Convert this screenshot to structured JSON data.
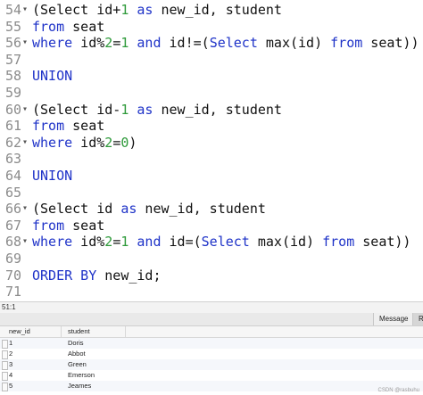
{
  "editor": {
    "lines": [
      {
        "n": "54",
        "fold": true,
        "tokens": [
          [
            "(Select id+",
            "t"
          ],
          [
            "1",
            "num"
          ],
          [
            " ",
            "t"
          ],
          [
            "as",
            "kw"
          ],
          [
            " new_id, student",
            "t"
          ]
        ]
      },
      {
        "n": "55",
        "fold": false,
        "tokens": [
          [
            "from",
            "kw"
          ],
          [
            " seat",
            "t"
          ]
        ]
      },
      {
        "n": "56",
        "fold": true,
        "tokens": [
          [
            "where",
            "kw"
          ],
          [
            " id%",
            "t"
          ],
          [
            "2",
            "num"
          ],
          [
            "=",
            "t"
          ],
          [
            "1",
            "num"
          ],
          [
            " ",
            "t"
          ],
          [
            "and",
            "kw"
          ],
          [
            " id!=(",
            "t"
          ],
          [
            "Select",
            "kw"
          ],
          [
            " max(id) ",
            "t"
          ],
          [
            "from",
            "kw"
          ],
          [
            " seat))",
            "t"
          ]
        ]
      },
      {
        "n": "57",
        "fold": false,
        "tokens": []
      },
      {
        "n": "58",
        "fold": false,
        "tokens": [
          [
            "UNION",
            "kw"
          ]
        ]
      },
      {
        "n": "59",
        "fold": false,
        "tokens": []
      },
      {
        "n": "60",
        "fold": true,
        "tokens": [
          [
            "(Select id-",
            "t"
          ],
          [
            "1",
            "num"
          ],
          [
            " ",
            "t"
          ],
          [
            "as",
            "kw"
          ],
          [
            " new_id, student",
            "t"
          ]
        ]
      },
      {
        "n": "61",
        "fold": false,
        "tokens": [
          [
            "from",
            "kw"
          ],
          [
            " seat",
            "t"
          ]
        ]
      },
      {
        "n": "62",
        "fold": true,
        "tokens": [
          [
            "where",
            "kw"
          ],
          [
            " id%",
            "t"
          ],
          [
            "2",
            "num"
          ],
          [
            "=",
            "t"
          ],
          [
            "0",
            "num"
          ],
          [
            ")",
            "t"
          ]
        ]
      },
      {
        "n": "63",
        "fold": false,
        "tokens": []
      },
      {
        "n": "64",
        "fold": false,
        "tokens": [
          [
            "UNION",
            "kw"
          ]
        ]
      },
      {
        "n": "65",
        "fold": false,
        "tokens": []
      },
      {
        "n": "66",
        "fold": true,
        "tokens": [
          [
            "(Select id ",
            "t"
          ],
          [
            "as",
            "kw"
          ],
          [
            " new_id, student",
            "t"
          ]
        ]
      },
      {
        "n": "67",
        "fold": false,
        "tokens": [
          [
            "from",
            "kw"
          ],
          [
            " seat",
            "t"
          ]
        ]
      },
      {
        "n": "68",
        "fold": true,
        "tokens": [
          [
            "where",
            "kw"
          ],
          [
            " id%",
            "t"
          ],
          [
            "2",
            "num"
          ],
          [
            "=",
            "t"
          ],
          [
            "1",
            "num"
          ],
          [
            " ",
            "t"
          ],
          [
            "and",
            "kw"
          ],
          [
            " id=(",
            "t"
          ],
          [
            "Select",
            "kw"
          ],
          [
            " max(id) ",
            "t"
          ],
          [
            "from",
            "kw"
          ],
          [
            " seat))",
            "t"
          ]
        ]
      },
      {
        "n": "69",
        "fold": false,
        "tokens": []
      },
      {
        "n": "70",
        "fold": false,
        "tokens": [
          [
            "ORDER BY",
            "kw"
          ],
          [
            " new_id;",
            "t"
          ]
        ]
      },
      {
        "n": "71",
        "fold": false,
        "tokens": []
      }
    ]
  },
  "status": {
    "position": "51:1"
  },
  "tabs": {
    "message": "Message",
    "result": "R"
  },
  "grid": {
    "columns": [
      "new_id",
      "student"
    ],
    "rows": [
      [
        "1",
        "Doris"
      ],
      [
        "2",
        "Abbot"
      ],
      [
        "3",
        "Green"
      ],
      [
        "4",
        "Emerson"
      ],
      [
        "5",
        "Jeames"
      ]
    ]
  },
  "watermark": "CSDN @rasbuhu",
  "colors": {
    "keyword": "#1f33c8",
    "number": "#2e9a3a",
    "text": "#111111",
    "gutter": "#8b8b8b"
  }
}
